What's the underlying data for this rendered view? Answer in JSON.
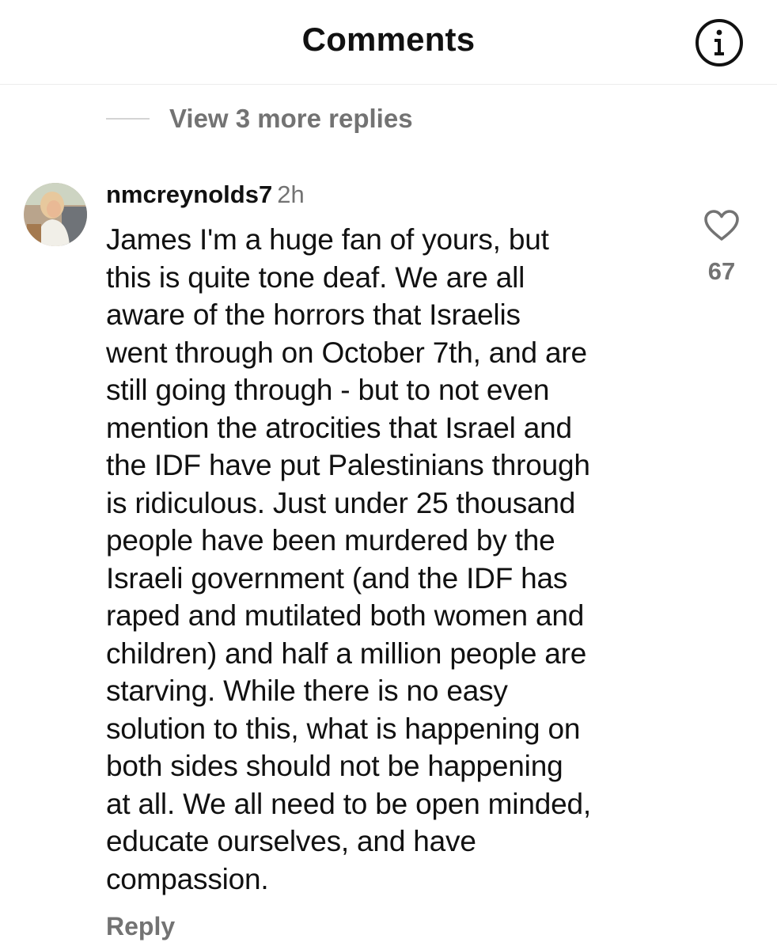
{
  "header": {
    "title": "Comments",
    "info_icon": "info-icon"
  },
  "thread": {
    "view_replies_label": "View 3 more replies"
  },
  "comment": {
    "username": "nmcreynolds7",
    "timestamp": "2h",
    "avatar_icon": "user-avatar",
    "text": "James I'm a huge fan of yours, but\nthis is quite tone deaf. We are all\naware of the horrors that Israelis\nwent through on October 7th, and are\nstill going through - but to not even\nmention the atrocities that Israel and\nthe IDF have put Palestinians through\nis ridiculous. Just under 25 thousand\npeople have been murdered by the\nIsraeli government (and the IDF has\nraped and mutilated both women and\nchildren) and half a million people are\nstarving. While there is no easy\nsolution to this, what is happening on\nboth sides should not be happening\nat all. We all need to be open minded,\neducate ourselves, and have\ncompassion.",
    "like_icon": "heart-icon",
    "like_count": "67",
    "reply_label": "Reply"
  },
  "colors": {
    "text_primary": "#111111",
    "text_secondary": "#737373",
    "divider": "#ececec"
  }
}
